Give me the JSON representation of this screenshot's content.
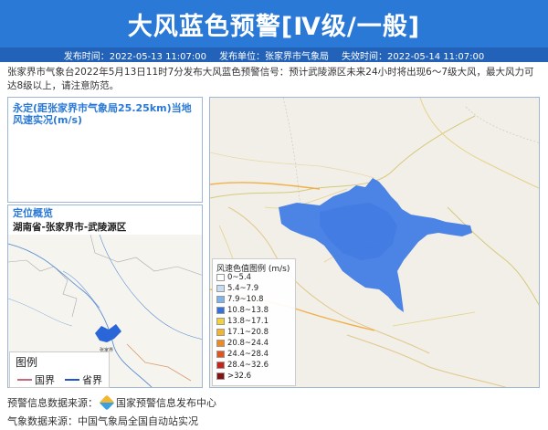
{
  "header": {
    "title": "大风蓝色预警[Ⅳ级/一般]"
  },
  "meta": {
    "publish_time": "发布时间：2022-05-13 11:07:00",
    "publisher": "发布单位：张家界市气象局",
    "expire_time": "失效时间：2022-05-14 11:07:00"
  },
  "description": "张家界市气象台2022年5月13日11时7分发布大风蓝色预警信号：预计武陵源区未来24小时将出现6～7级大风，最大风力可达8级以上，请注意防范。",
  "wind_panel": {
    "title": "永定(距张家界市气象局25.25km)当地风速实况(m/s)"
  },
  "location_panel": {
    "title": "定位概览",
    "region": "湖南省-张家界市-武陵源区",
    "map_label": "张家界"
  },
  "map_legend": {
    "title": "图例",
    "items": [
      {
        "label": "国界",
        "color": "#c86a7a"
      },
      {
        "label": "省界",
        "color": "#2255cc"
      }
    ]
  },
  "speed_legend": {
    "title": "风速色值图例 (m/s)",
    "items": [
      {
        "label": "0~5.4",
        "color": "#ffffff"
      },
      {
        "label": "5.4~7.9",
        "color": "#c5ddf5"
      },
      {
        "label": "7.9~10.8",
        "color": "#7fb3ee"
      },
      {
        "label": "10.8~13.8",
        "color": "#3370e0"
      },
      {
        "label": "13.8~17.1",
        "color": "#f2d13a"
      },
      {
        "label": "17.1~20.8",
        "color": "#f5b52a"
      },
      {
        "label": "20.8~24.4",
        "color": "#f08a1e"
      },
      {
        "label": "24.4~28.4",
        "color": "#e4541a"
      },
      {
        "label": "28.4~32.6",
        "color": "#c82318"
      },
      {
        "label": ">32.6",
        "color": "#8a0f12"
      }
    ]
  },
  "footer": {
    "warning_source_label": "预警信息数据来源：",
    "warning_source": "国家预警信息发布中心",
    "weather_source": "气象数据来源：中国气象局全国自动站实况"
  }
}
